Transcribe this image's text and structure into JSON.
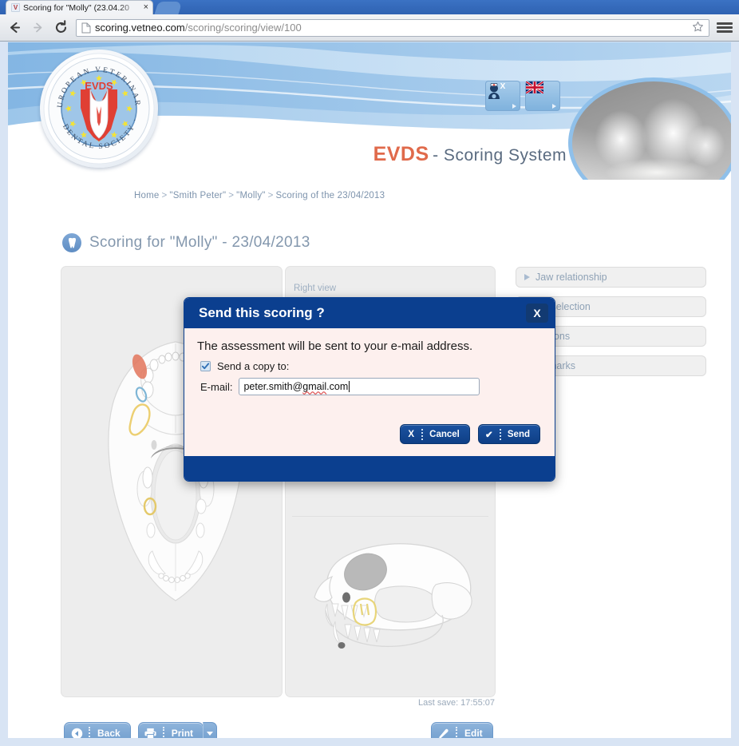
{
  "browser": {
    "tab": {
      "title": "Scoring for \"Molly\" (23.04.20",
      "favicon_letter": "V",
      "close_label": "×"
    },
    "nav": {
      "back_icon": "back-arrow-icon",
      "forward_icon": "forward-arrow-icon",
      "reload_icon": "reload-icon"
    },
    "url": {
      "host": "scoring.vetneo.com",
      "path": "/scoring/scoring/view/100",
      "page_icon": "page-document-icon"
    },
    "star_icon": "bookmark-star-icon",
    "menu_icon": "hamburger-menu-icon"
  },
  "header": {
    "logo": {
      "ring_top_text": "EUROPEAN VETERINARY",
      "ring_bottom_text": "DENTAL SOCIETY",
      "center_text": "EVDS"
    },
    "brand_primary": "EVDS",
    "brand_secondary": "- Scoring System",
    "icons": [
      {
        "name": "vet-logout-icon",
        "title": "vet-user-logout"
      },
      {
        "name": "uk-flag-language-icon",
        "title": "language-english"
      }
    ],
    "xray_alt": "dental-xray-thumbnail"
  },
  "breadcrumb": {
    "items": [
      "Home",
      "\"Smith Peter\"",
      "\"Molly\"",
      "Scoring of the 23/04/2013"
    ],
    "separator": ">"
  },
  "page_title": "Scoring for \"Molly\" -  23/04/2013",
  "main": {
    "left_panel": {
      "view_label": "",
      "art": "canine-oral-cavity-ventral-diagram"
    },
    "right_top_panel": {
      "view_label": "Right view",
      "art": "feline-skull-lateral-top-diagram"
    },
    "right_bottom_panel": {
      "view_label": "",
      "art": "feline-skull-lateral-diagram"
    },
    "last_save": "Last save: 17:55:07"
  },
  "accordion": {
    "items": [
      {
        "label": "Jaw relationship"
      },
      {
        "label": "No selection"
      },
      {
        "label": "Options"
      },
      {
        "label": "Remarks"
      }
    ]
  },
  "actions": {
    "back": {
      "label": "Back",
      "icon": "back-circle-icon"
    },
    "print": {
      "label": "Print",
      "icon": "printer-icon",
      "dropdown_icon": "chevron-down-icon"
    },
    "edit": {
      "label": "Edit",
      "icon": "pencil-icon"
    }
  },
  "dialog": {
    "title": "Send this scoring ?",
    "close_label": "X",
    "message": "The assessment will be sent to your e-mail address.",
    "checkbox": {
      "label": "Send a copy to:",
      "checked": true,
      "mark": "✓"
    },
    "email": {
      "label": "E-mail:",
      "value_main": "peter.smith@",
      "value_spell": "gmail",
      "value_tail": ".com"
    },
    "cancel": {
      "label": "Cancel",
      "icon": "x-mark-icon",
      "glyph": "X"
    },
    "send": {
      "label": "Send",
      "icon": "check-mark-icon",
      "glyph": "✔"
    }
  },
  "colors": {
    "dialog_navy": "#0b3f8f",
    "dialog_body": "#fdf0ee",
    "brand_orange": "#e06a4b",
    "brand_blue": "#5a6b80",
    "button_blue": "#6e9ccd"
  }
}
